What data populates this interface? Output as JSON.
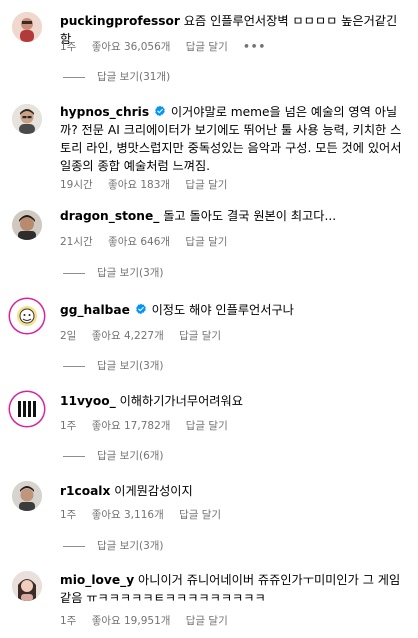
{
  "comments": [
    {
      "username": "puckingprofessor",
      "text": "요즘 인플루언서장벽 ㅁㅁㅁㅁ 높은거같긴함",
      "verified": false,
      "age": "1주",
      "likes": "좋아요 36,056개",
      "reply": "답글 달기",
      "more": "•••",
      "replies": "답글 보기(31개)"
    },
    {
      "username": "hypnos_chris",
      "text": "이거야말로 meme을 넘은 예술의 영역 아닐까? 전문 AI 크리에이터가 보기에도 뛰어난 툴 사용 능력, 키치한 스토리 라인, 병맛스럽지만 중독성있는 음악과 구성. 모든 것에 있어서 일종의 종합 예술처럼 느껴짐.",
      "verified": true,
      "age": "19시간",
      "likes": "좋아요 183개",
      "reply": "답글 달기"
    },
    {
      "username": "dragon_stone_",
      "text": "돌고 돌아도 결국 원본이 최고다...",
      "verified": false,
      "age": "21시간",
      "likes": "좋아요 646개",
      "reply": "답글 달기",
      "replies": "답글 보기(3개)"
    },
    {
      "username": "gg_halbae",
      "text": "이정도 해야 인플루언서구나",
      "verified": true,
      "age": "2일",
      "likes": "좋아요 4,227개",
      "reply": "답글 달기",
      "replies": "답글 보기(3개)"
    },
    {
      "username": "11vyoo_",
      "text": "이해하기가너무어려워요",
      "verified": false,
      "age": "1주",
      "likes": "좋아요 17,782개",
      "reply": "답글 달기",
      "replies": "답글 보기(6개)"
    },
    {
      "username": "r1coalx",
      "text": "이게뭔감성이지",
      "verified": false,
      "age": "1주",
      "likes": "좋아요 3,116개",
      "reply": "답글 달기",
      "replies": "답글 보기(3개)"
    },
    {
      "username": "mio_love_y",
      "text": "아니이거 쥬니어네이버 쥬쥬인가ㅜ미미인가 그 게임 같음 ㅠㅋㅋㅋㅋㅋㅌㅋㅋㅋㅋㅋㅋㅋㅋㅋ",
      "verified": false,
      "age": "1주",
      "likes": "좋아요 19,951개",
      "reply": "답글 달기"
    }
  ],
  "colors": {
    "text": "#000000",
    "secondary": "#737373",
    "verified_badge": "#0095f6",
    "story_ring": "#d6249f"
  }
}
